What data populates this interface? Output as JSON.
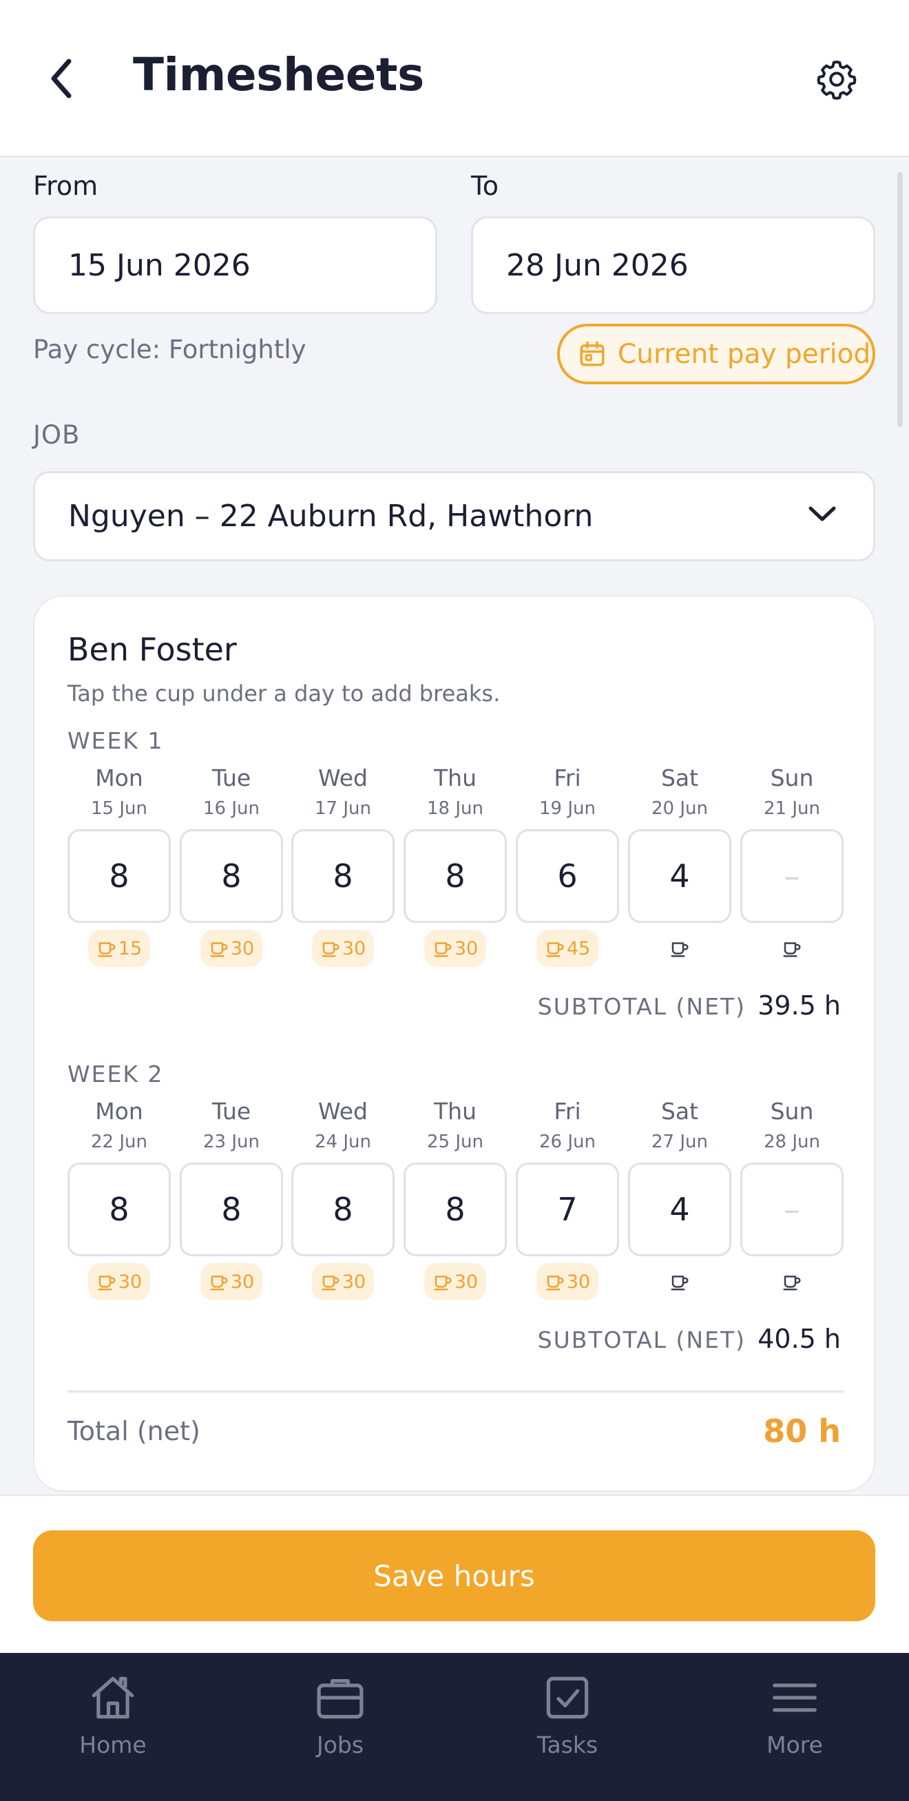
{
  "header": {
    "title": "Timesheets"
  },
  "date_range": {
    "from_label": "From",
    "from_value": "15 Jun 2026",
    "to_label": "To",
    "to_value": "28 Jun 2026",
    "pay_cycle": "Pay cycle: Fortnightly",
    "current_period_label": "Current pay period"
  },
  "job": {
    "label": "JOB",
    "value": "Nguyen – 22 Auburn Rd, Hawthorn"
  },
  "card": {
    "worker": "Ben Foster",
    "hint": "Tap the cup under a day to add breaks.",
    "subtotal_label": "SUBTOTAL (NET)",
    "total_label": "Total (net)",
    "total_value": "80 h",
    "weeks": [
      {
        "label": "WEEK 1",
        "subtotal": "39.5 h",
        "days": [
          {
            "name": "Mon",
            "date": "15 Jun",
            "hours": "8",
            "break": "15"
          },
          {
            "name": "Tue",
            "date": "16 Jun",
            "hours": "8",
            "break": "30"
          },
          {
            "name": "Wed",
            "date": "17 Jun",
            "hours": "8",
            "break": "30"
          },
          {
            "name": "Thu",
            "date": "18 Jun",
            "hours": "8",
            "break": "30"
          },
          {
            "name": "Fri",
            "date": "19 Jun",
            "hours": "6",
            "break": "45"
          },
          {
            "name": "Sat",
            "date": "20 Jun",
            "hours": "4",
            "break": ""
          },
          {
            "name": "Sun",
            "date": "21 Jun",
            "hours": "–",
            "break": ""
          }
        ]
      },
      {
        "label": "WEEK 2",
        "subtotal": "40.5 h",
        "days": [
          {
            "name": "Mon",
            "date": "22 Jun",
            "hours": "8",
            "break": "30"
          },
          {
            "name": "Tue",
            "date": "23 Jun",
            "hours": "8",
            "break": "30"
          },
          {
            "name": "Wed",
            "date": "24 Jun",
            "hours": "8",
            "break": "30"
          },
          {
            "name": "Thu",
            "date": "25 Jun",
            "hours": "8",
            "break": "30"
          },
          {
            "name": "Fri",
            "date": "26 Jun",
            "hours": "7",
            "break": "30"
          },
          {
            "name": "Sat",
            "date": "27 Jun",
            "hours": "4",
            "break": ""
          },
          {
            "name": "Sun",
            "date": "28 Jun",
            "hours": "–",
            "break": ""
          }
        ]
      }
    ]
  },
  "actions": {
    "save_label": "Save hours"
  },
  "nav": {
    "items": [
      {
        "label": "Home",
        "icon": "home-icon"
      },
      {
        "label": "Jobs",
        "icon": "briefcase-icon"
      },
      {
        "label": "Tasks",
        "icon": "checkbox-icon"
      },
      {
        "label": "More",
        "icon": "menu-icon"
      }
    ]
  },
  "colors": {
    "accent": "#f2a62a",
    "nav_bg": "#1c2035",
    "text": "#1b1f33",
    "muted": "#6b7080"
  }
}
